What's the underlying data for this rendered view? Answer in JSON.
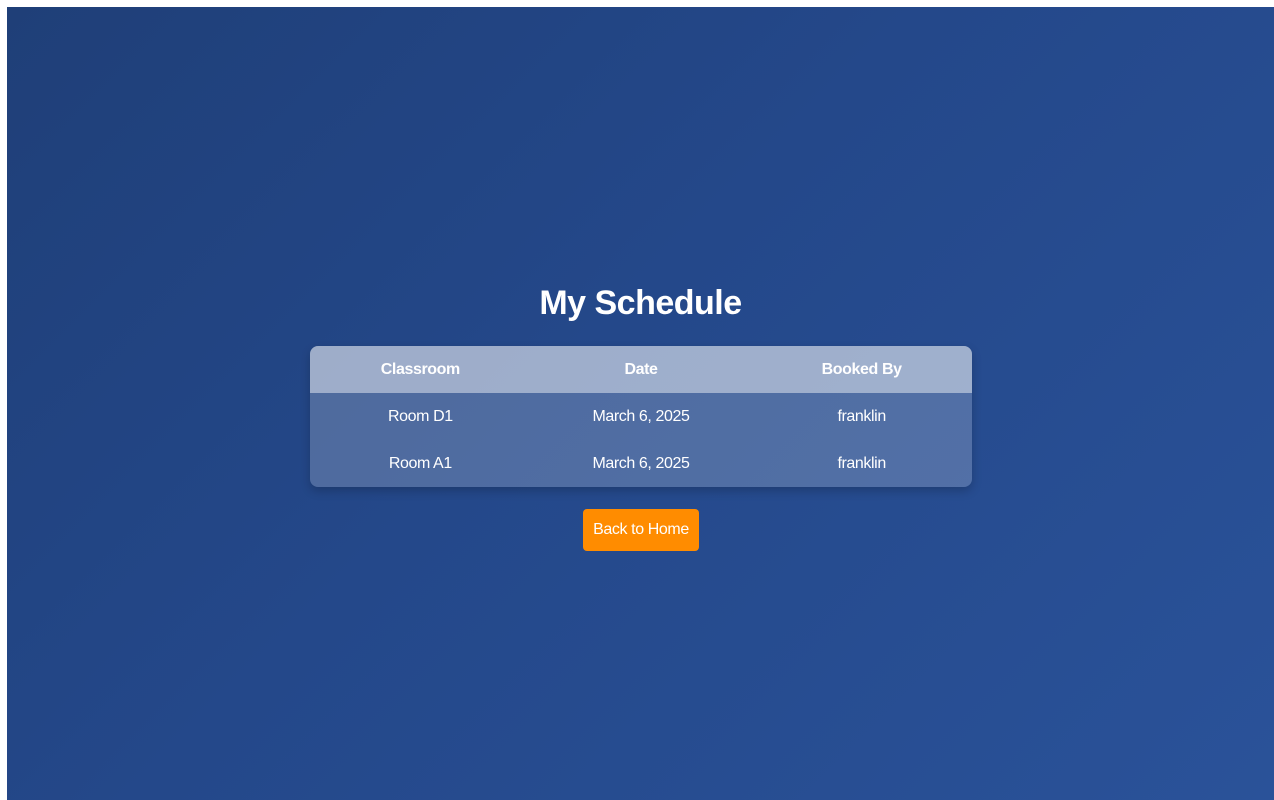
{
  "page_title": "My Schedule",
  "table": {
    "headers": [
      "Classroom",
      "Date",
      "Booked By"
    ],
    "rows": [
      [
        "Room D1",
        "March 6, 2025",
        "franklin"
      ],
      [
        "Room A1",
        "March 6, 2025",
        "franklin"
      ]
    ]
  },
  "back_button_label": "Back to Home",
  "colors": {
    "background_start": "#1f3f78",
    "background_end": "#2a5299",
    "button_accent": "#ff8c00",
    "text": "#ffffff"
  }
}
